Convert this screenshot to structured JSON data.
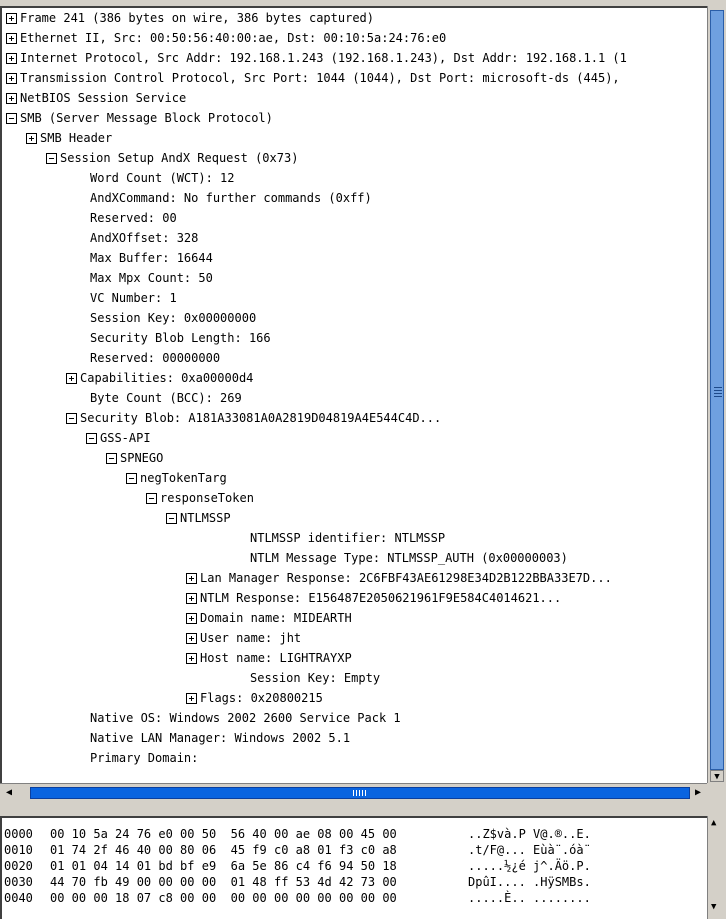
{
  "tree": [
    {
      "text": "Frame 241 (386 bytes on wire, 386 bytes captured)",
      "toggle": "+"
    },
    {
      "text": "Ethernet II, Src: 00:50:56:40:00:ae, Dst: 00:10:5a:24:76:e0",
      "toggle": "+"
    },
    {
      "text": "Internet Protocol, Src Addr: 192.168.1.243 (192.168.1.243), Dst Addr: 192.168.1.1 (1",
      "toggle": "+"
    },
    {
      "text": "Transmission Control Protocol, Src Port: 1044 (1044), Dst Port: microsoft-ds (445),",
      "toggle": "+"
    },
    {
      "text": "NetBIOS Session Service",
      "toggle": "+"
    },
    {
      "text": "SMB (Server Message Block Protocol)",
      "toggle": "-"
    },
    {
      "text": "SMB Header",
      "toggle": "+"
    },
    {
      "text": "Session Setup AndX Request (0x73)",
      "toggle": "-"
    },
    {
      "text": "Word Count (WCT): 12",
      "toggle": ""
    },
    {
      "text": "AndXCommand: No further commands (0xff)",
      "toggle": ""
    },
    {
      "text": "Reserved: 00",
      "toggle": ""
    },
    {
      "text": "AndXOffset: 328",
      "toggle": ""
    },
    {
      "text": "Max Buffer: 16644",
      "toggle": ""
    },
    {
      "text": "Max Mpx Count: 50",
      "toggle": ""
    },
    {
      "text": "VC Number: 1",
      "toggle": ""
    },
    {
      "text": "Session Key: 0x00000000",
      "toggle": ""
    },
    {
      "text": "Security Blob Length: 166",
      "toggle": ""
    },
    {
      "text": "Reserved: 00000000",
      "toggle": ""
    },
    {
      "text": "Capabilities: 0xa00000d4",
      "toggle": "+"
    },
    {
      "text": "Byte Count (BCC): 269",
      "toggle": ""
    },
    {
      "text": "Security Blob: A181A33081A0A2819D04819A4E544C4D...",
      "toggle": "-"
    },
    {
      "text": "GSS-API",
      "toggle": "-"
    },
    {
      "text": "SPNEGO",
      "toggle": "-"
    },
    {
      "text": "negTokenTarg",
      "toggle": "-"
    },
    {
      "text": "responseToken",
      "toggle": "-"
    },
    {
      "text": "NTLMSSP",
      "toggle": "-"
    },
    {
      "text": "NTLMSSP identifier: NTLMSSP",
      "toggle": ""
    },
    {
      "text": "NTLM Message Type: NTLMSSP_AUTH (0x00000003)",
      "toggle": ""
    },
    {
      "text": "Lan Manager Response: 2C6FBF43AE61298E34D2B122BBA33E7D...",
      "toggle": "+"
    },
    {
      "text": "NTLM Response: E156487E2050621961F9E584C4014621...",
      "toggle": "+"
    },
    {
      "text": "Domain name: MIDEARTH",
      "toggle": "+"
    },
    {
      "text": "User name: jht",
      "toggle": "+"
    },
    {
      "text": "Host name: LIGHTRAYXP",
      "toggle": "+"
    },
    {
      "text": "Session Key: Empty",
      "toggle": ""
    },
    {
      "text": "Flags: 0x20800215",
      "toggle": "+"
    },
    {
      "text": "Native OS: Windows 2002 2600 Service Pack 1",
      "toggle": ""
    },
    {
      "text": "Native LAN Manager: Windows 2002 5.1",
      "toggle": ""
    },
    {
      "text": "Primary Domain:",
      "toggle": ""
    }
  ],
  "hex": [
    {
      "offset": "0000",
      "bytes": "00 10 5a 24 76 e0 00 50  56 40 00 ae 08 00 45 00",
      "ascii": "..Z$và.P V@.®..E."
    },
    {
      "offset": "0010",
      "bytes": "01 74 2f 46 40 00 80 06  45 f9 c0 a8 01 f3 c0 a8",
      "ascii": ".t/F@... Eùà¨.óà¨"
    },
    {
      "offset": "0020",
      "bytes": "01 01 04 14 01 bd bf e9  6a 5e 86 c4 f6 94 50 18",
      "ascii": ".....½¿é j^.Äö.P."
    },
    {
      "offset": "0030",
      "bytes": "44 70 fb 49 00 00 00 00  01 48 ff 53 4d 42 73 00",
      "ascii": "DpûI.... .HÿSMBs."
    },
    {
      "offset": "0040",
      "bytes": "00 00 00 18 07 c8 00 00  00 00 00 00 00 00 00 00",
      "ascii": ".....È.. ........"
    }
  ]
}
